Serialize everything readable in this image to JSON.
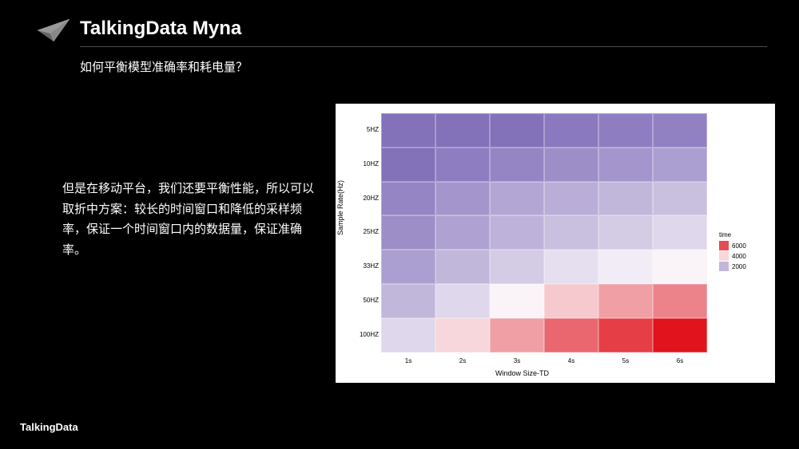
{
  "header": {
    "title": "TalkingData Myna",
    "subtitle": "如何平衡模型准确率和耗电量？"
  },
  "body": {
    "text": "但是在移动平台，我们还要平衡性能，所以可以取折中方案：较长的时间窗口和降低的采样频率，保证一个时间窗口内的数据量，保证准确率。"
  },
  "footer": {
    "brand": "TalkingData"
  },
  "chart_data": {
    "type": "heatmap",
    "title": "",
    "xlabel": "Window Size-TD",
    "ylabel": "Sample Rate(Hz)",
    "x_categories": [
      "1s",
      "2s",
      "3s",
      "4s",
      "5s",
      "6s"
    ],
    "y_categories": [
      "5HZ",
      "10HZ",
      "20HZ",
      "25HZ",
      "33HZ",
      "50HZ",
      "100HZ"
    ],
    "values": [
      [
        300,
        300,
        300,
        500,
        600,
        700
      ],
      [
        300,
        600,
        800,
        1000,
        1200,
        1400
      ],
      [
        800,
        1200,
        1600,
        1800,
        2000,
        2200
      ],
      [
        1000,
        1500,
        1900,
        2200,
        2500,
        2800
      ],
      [
        1400,
        2000,
        2500,
        3000,
        3300,
        3600
      ],
      [
        2000,
        2800,
        3600,
        4200,
        4800,
        5200
      ],
      [
        2800,
        4000,
        4800,
        5600,
        6200,
        6800
      ]
    ],
    "legend": {
      "title": "time",
      "ticks": [
        6000,
        4000,
        2000
      ]
    }
  }
}
